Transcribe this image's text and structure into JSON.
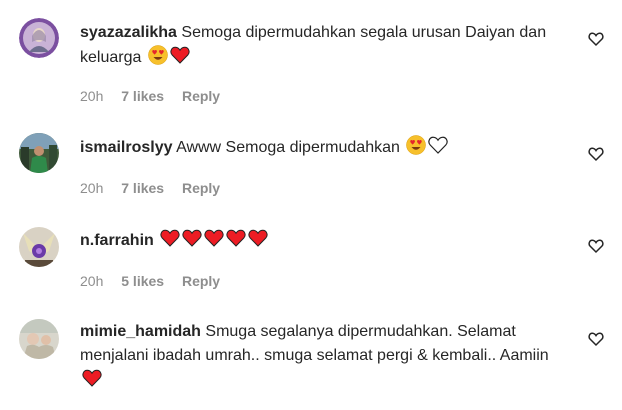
{
  "comments": [
    {
      "username": "syazazalikha",
      "text": "Semoga dipermudahkan segala urusan Daiyan dan keluarga",
      "emojis": [
        "heart-eyes",
        "red-heart"
      ],
      "time": "20h",
      "likes": "7 likes",
      "reply": "Reply"
    },
    {
      "username": "ismailroslyy",
      "text": "Awww Semoga dipermudahkan",
      "emojis": [
        "heart-eyes",
        "white-heart"
      ],
      "time": "20h",
      "likes": "7 likes",
      "reply": "Reply"
    },
    {
      "username": "n.farrahin",
      "text": "",
      "emojis": [
        "red-heart",
        "red-heart",
        "red-heart",
        "red-heart",
        "red-heart"
      ],
      "time": "20h",
      "likes": "5 likes",
      "reply": "Reply"
    },
    {
      "username": "mimie_hamidah",
      "text": "Smuga segalanya dipermudahkan. Selamat menjalani ibadah umrah.. smuga selamat pergi & kembali.. Aamiin",
      "emojis": [
        "red-heart"
      ],
      "time": "",
      "likes": "",
      "reply": ""
    }
  ],
  "colors": {
    "text": "#262626",
    "secondary": "#8e8e8e",
    "heart": "#ed1c24"
  }
}
